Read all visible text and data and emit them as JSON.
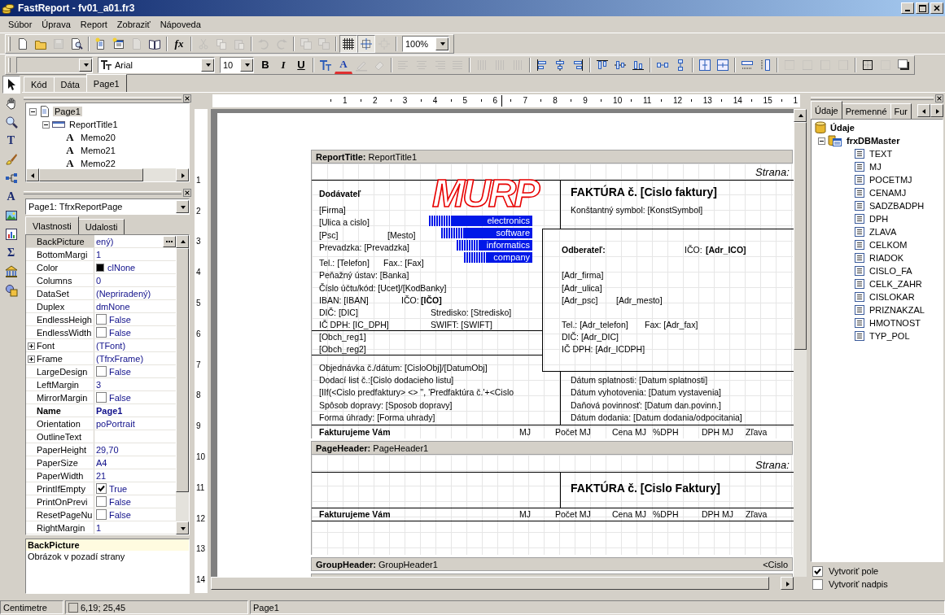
{
  "window": {
    "title": "FastReport - fv01_a01.fr3"
  },
  "menu": [
    "Súbor",
    "Úprava",
    "Report",
    "Zobraziť",
    "Nápoveda"
  ],
  "toolbar_main": [
    {
      "kind": "new",
      "disabled": false
    },
    {
      "kind": "open",
      "disabled": false
    },
    {
      "kind": "save",
      "disabled": true
    },
    {
      "kind": "preview",
      "disabled": false
    },
    {
      "kind": "separator"
    },
    {
      "kind": "add-page",
      "disabled": false
    },
    {
      "kind": "add-form",
      "disabled": false
    },
    {
      "kind": "delete-page",
      "disabled": true
    },
    {
      "kind": "book",
      "disabled": false
    },
    {
      "kind": "separator"
    },
    {
      "kind": "fx",
      "label": "fx",
      "disabled": false
    },
    {
      "kind": "separator"
    },
    {
      "kind": "cut",
      "disabled": true
    },
    {
      "kind": "copy",
      "disabled": true
    },
    {
      "kind": "paste",
      "disabled": true
    },
    {
      "kind": "separator"
    },
    {
      "kind": "undo",
      "disabled": true
    },
    {
      "kind": "redo",
      "disabled": true
    },
    {
      "kind": "separator"
    },
    {
      "kind": "group",
      "disabled": true
    },
    {
      "kind": "ungroup",
      "disabled": true
    },
    {
      "kind": "separator"
    },
    {
      "kind": "grid",
      "disabled": false,
      "on": true
    },
    {
      "kind": "snap",
      "disabled": false,
      "on": true
    },
    {
      "kind": "fit",
      "disabled": true,
      "on": false
    }
  ],
  "zoom_combo": {
    "value": "100%"
  },
  "toolbar_format": {
    "style_combo": {
      "disabled": true
    },
    "font_combo": {
      "value": "Arial"
    },
    "size_combo": {
      "value": "10"
    },
    "buttons": [
      {
        "kind": "bold",
        "label": "B",
        "disabled": false
      },
      {
        "kind": "italic",
        "label": "I",
        "disabled": false
      },
      {
        "kind": "underline",
        "label": "U",
        "disabled": false
      },
      {
        "kind": "separator"
      },
      {
        "kind": "font-style",
        "disabled": false
      },
      {
        "kind": "font-color",
        "label": "A",
        "disabled": false
      },
      {
        "kind": "highlight",
        "disabled": true
      },
      {
        "kind": "eraser",
        "disabled": true
      },
      {
        "kind": "separator"
      },
      {
        "kind": "text-left",
        "disabled": true
      },
      {
        "kind": "text-center",
        "disabled": true
      },
      {
        "kind": "text-right",
        "disabled": true
      },
      {
        "kind": "justify",
        "disabled": true
      },
      {
        "kind": "separator"
      },
      {
        "kind": "vbars",
        "disabled": true
      },
      {
        "kind": "vbars",
        "disabled": true
      },
      {
        "kind": "vbars",
        "disabled": true
      },
      {
        "kind": "separator"
      },
      {
        "kind": "align-left",
        "disabled": false
      },
      {
        "kind": "align-hcenter",
        "disabled": false
      },
      {
        "kind": "align-right",
        "disabled": false
      },
      {
        "kind": "separator"
      },
      {
        "kind": "align-top",
        "disabled": false
      },
      {
        "kind": "align-vcenter",
        "disabled": false
      },
      {
        "kind": "align-bottom",
        "disabled": false
      },
      {
        "kind": "separator"
      },
      {
        "kind": "space-h",
        "disabled": false
      },
      {
        "kind": "space-v",
        "disabled": false
      },
      {
        "kind": "separator"
      },
      {
        "kind": "center-h",
        "disabled": false
      },
      {
        "kind": "center-v",
        "disabled": false
      },
      {
        "kind": "separator"
      },
      {
        "kind": "same-width",
        "disabled": false
      },
      {
        "kind": "same-height",
        "disabled": false
      },
      {
        "kind": "separator"
      },
      {
        "kind": "frame-top",
        "disabled": true
      },
      {
        "kind": "frame-bottom",
        "disabled": true
      },
      {
        "kind": "frame-left",
        "disabled": true
      },
      {
        "kind": "frame-right",
        "disabled": true
      },
      {
        "kind": "separator"
      },
      {
        "kind": "frame-all",
        "disabled": false
      },
      {
        "kind": "frame-none",
        "disabled": true
      },
      {
        "kind": "shadow",
        "disabled": false
      }
    ]
  },
  "tool_palette": [
    {
      "kind": "select",
      "selected": true
    },
    {
      "kind": "hand",
      "selected": false
    },
    {
      "kind": "zoom",
      "selected": false
    },
    {
      "kind": "text-tool",
      "label": "T",
      "selected": false
    },
    {
      "kind": "brush",
      "selected": false
    },
    {
      "kind": "connector",
      "selected": false
    },
    {
      "kind": "memo",
      "label": "A",
      "selected": false
    },
    {
      "kind": "picture",
      "selected": false
    },
    {
      "kind": "chart",
      "selected": false
    },
    {
      "kind": "sum",
      "label": "Σ",
      "selected": false
    },
    {
      "kind": "bank",
      "selected": false
    },
    {
      "kind": "shapes",
      "selected": false
    }
  ],
  "doc_tabs": [
    {
      "label": "Kód",
      "selected": false
    },
    {
      "label": "Dáta",
      "selected": false
    },
    {
      "label": "Page1",
      "selected": true
    }
  ],
  "report_tree": [
    {
      "label": "Page1",
      "kind": "page",
      "selected": true,
      "expanded": true,
      "children": [
        {
          "label": "ReportTitle1",
          "kind": "band",
          "selected": false,
          "expanded": true,
          "children": [
            {
              "label": "Memo20",
              "kind": "memo",
              "glyph": "A",
              "selected": false
            },
            {
              "label": "Memo21",
              "kind": "memo",
              "glyph": "A",
              "selected": false
            },
            {
              "label": "Memo22",
              "kind": "memo",
              "glyph": "A",
              "selected": false
            }
          ]
        }
      ]
    }
  ],
  "object_combo": {
    "value": "Page1: TfrxReportPage"
  },
  "inspector_tabs": [
    {
      "label": "Vlastnosti",
      "selected": true
    },
    {
      "label": "Udalosti",
      "selected": false
    }
  ],
  "properties": [
    {
      "name": "BackPicture",
      "value": "ený)",
      "kind": "picture",
      "selected": true,
      "bold": false
    },
    {
      "name": "BottomMargi",
      "value": "1",
      "kind": "text",
      "selected": false,
      "bold": false
    },
    {
      "name": "Color",
      "value": "clNone",
      "kind": "color",
      "color": "#000000",
      "selected": false,
      "bold": false
    },
    {
      "name": "Columns",
      "value": "0",
      "kind": "text",
      "selected": false,
      "bold": false
    },
    {
      "name": "DataSet",
      "value": "(Nepriradený)",
      "kind": "text",
      "selected": false,
      "bold": false
    },
    {
      "name": "Duplex",
      "value": "dmNone",
      "kind": "text",
      "selected": false,
      "bold": false
    },
    {
      "name": "EndlessHeigh",
      "value": "False",
      "kind": "check",
      "checked": false,
      "selected": false,
      "bold": false
    },
    {
      "name": "EndlessWidth",
      "value": "False",
      "kind": "check",
      "checked": false,
      "selected": false,
      "bold": false
    },
    {
      "name": "Font",
      "value": "(TFont)",
      "kind": "expand",
      "expanded": false,
      "selected": false,
      "bold": false
    },
    {
      "name": "Frame",
      "value": "(TfrxFrame)",
      "kind": "expand",
      "expanded": false,
      "selected": false,
      "bold": false
    },
    {
      "name": "LargeDesign",
      "value": "False",
      "kind": "check",
      "checked": false,
      "selected": false,
      "bold": false
    },
    {
      "name": "LeftMargin",
      "value": "3",
      "kind": "text",
      "selected": false,
      "bold": false
    },
    {
      "name": "MirrorMargin",
      "value": "False",
      "kind": "check",
      "checked": false,
      "selected": false,
      "bold": false
    },
    {
      "name": "Name",
      "value": "Page1",
      "kind": "text",
      "selected": false,
      "bold": true
    },
    {
      "name": "Orientation",
      "value": "poPortrait",
      "kind": "text",
      "selected": false,
      "bold": false
    },
    {
      "name": "OutlineText",
      "kind": "text",
      "selected": false,
      "bold": false
    },
    {
      "name": "PaperHeight",
      "value": "29,70",
      "kind": "text",
      "selected": false,
      "bold": false
    },
    {
      "name": "PaperSize",
      "value": "A4",
      "kind": "text",
      "selected": false,
      "bold": false
    },
    {
      "name": "PaperWidth",
      "value": "21",
      "kind": "text",
      "selected": false,
      "bold": false
    },
    {
      "name": "PrintIfEmpty",
      "value": "True",
      "kind": "check",
      "checked": true,
      "selected": false,
      "bold": false
    },
    {
      "name": "PrintOnPrevi",
      "value": "False",
      "kind": "check",
      "checked": false,
      "selected": false,
      "bold": false
    },
    {
      "name": "ResetPageNu",
      "value": "False",
      "kind": "check",
      "checked": false,
      "selected": false,
      "bold": false
    },
    {
      "name": "RightMargin",
      "value": "1",
      "kind": "text",
      "selected": false,
      "bold": false
    }
  ],
  "description": {
    "title": "BackPicture",
    "text": "Obrázok v pozadí strany"
  },
  "ruler": [
    "1",
    "2",
    "3",
    "4",
    "5",
    "6",
    "7",
    "8",
    "9",
    "10",
    "11",
    "12",
    "13",
    "14",
    "15",
    "1"
  ],
  "vertical_ruler": [
    "1",
    "2",
    "3",
    "4",
    "5",
    "6",
    "7",
    "8",
    "9",
    "10",
    "11",
    "12",
    "13",
    "14"
  ],
  "report": {
    "bands": [
      {
        "kind": "report_title",
        "header": "**ReportTitle:** ReportTitle1",
        "memos": [
          "Strana:",
          "Dodávateľ",
          "[Firma]",
          "[Ulica a cislo]",
          "[Psc]",
          "[Mesto]",
          "Prevadzka: [Prevadzka]",
          "Tel.: [Telefon]",
          "Fax.: [Fax]",
          "Peňažný ústav: [Banka]",
          "Číslo účtu/kód: [Ucet]/[KodBanky]",
          "IBAN: [IBAN]",
          "IČO:",
          "[IČO]",
          "DIČ: [DIC]",
          "Stredisko: [Stredisko]",
          "IČ DPH: [IC_DPH]",
          "SWIFT: [SWIFT]",
          "[Obch_reg1]",
          "[Obch_reg2]",
          "Objednávka č./dátum: [CisloObj]/[DatumObj]",
          "Dodací list č.:[Cislo dodacieho listu]",
          "[IIf(<Cislo predfaktury> <> '', 'Predfaktúra č.'+<Cislo",
          "Spôsob dopravy: [Sposob dopravy]",
          "Forma úhrady: [Forma uhrady]",
          "FAKTÚRA č. [Cislo faktury]",
          "Konštantný symbol: [KonstSymbol]",
          "Odberateľ:",
          "IČO:",
          "[Adr_ICO]",
          "[Adr_firma]",
          "[Adr_ulica]",
          "[Adr_psc]",
          "[Adr_mesto]",
          "Tel.: [Adr_telefon]",
          "Fax: [Adr_fax]",
          "DIČ: [Adr_DIC]",
          "IČ DPH: [Adr_ICDPH]",
          "Dátum splatnosti: [Datum splatnosti]",
          "Dátum vyhotovenia: [Datum vystavenia]",
          "Daňová povinnosť: [Datum dan.povinn.]",
          "Dátum dodania: [Datum dodania/odpocitania]"
        ],
        "logo": {
          "mark": "MURP",
          "lines": [
            "electronics",
            "software",
            "informatics",
            "company"
          ]
        },
        "columns": [
          "Fakturujeme Vám",
          "MJ",
          "Počet MJ",
          "Cena MJ",
          "%DPH",
          "DPH MJ",
          "Zľava"
        ]
      },
      {
        "kind": "page_header",
        "header": "**PageHeader:** PageHeader1",
        "memos": [
          "Strana:",
          "FAKTÚRA č. [Cislo Faktury]"
        ],
        "columns": [
          "Fakturujeme Vám",
          "MJ",
          "Počet MJ",
          "Cena MJ",
          "%DPH",
          "DPH MJ",
          "Zľava"
        ]
      },
      {
        "kind": "group_header",
        "header": "**GroupHeader:** GroupHeader1",
        "condition": "<Cislo"
      }
    ]
  },
  "data_tabs": [
    {
      "label": "Údaje",
      "selected": true
    },
    {
      "label": "Premenné",
      "selected": false
    },
    {
      "label": "Fur",
      "selected": false
    }
  ],
  "data_tree": [
    {
      "label": "Údaje",
      "kind": "root",
      "children": [
        {
          "label": "frxDBMaster",
          "kind": "dataset",
          "expanded": true,
          "children": [
            {
              "label": "TEXT",
              "kind": "field"
            },
            {
              "label": "MJ",
              "kind": "field"
            },
            {
              "label": "POCETMJ",
              "kind": "field"
            },
            {
              "label": "CENAMJ",
              "kind": "field"
            },
            {
              "label": "SADZBADPH",
              "kind": "field"
            },
            {
              "label": "DPH",
              "kind": "field"
            },
            {
              "label": "ZLAVA",
              "kind": "field"
            },
            {
              "label": "CELKOM",
              "kind": "field"
            },
            {
              "label": "RIADOK",
              "kind": "field"
            },
            {
              "label": "CISLO_FA",
              "kind": "field"
            },
            {
              "label": "CELK_ZAHR",
              "kind": "field"
            },
            {
              "label": "CISLOKAR",
              "kind": "field"
            },
            {
              "label": "PRIZNAKZAL",
              "kind": "field"
            },
            {
              "label": "HMOTNOST",
              "kind": "field"
            },
            {
              "label": "TYP_POL",
              "kind": "field"
            }
          ]
        }
      ]
    }
  ],
  "options": [
    {
      "label": "Vytvoriť pole",
      "checked": true
    },
    {
      "label": "Vytvoriť nadpis",
      "checked": false
    }
  ],
  "status_bar": {
    "units": "Centimetre",
    "position": "6,19; 25,45",
    "page": "Page1"
  }
}
